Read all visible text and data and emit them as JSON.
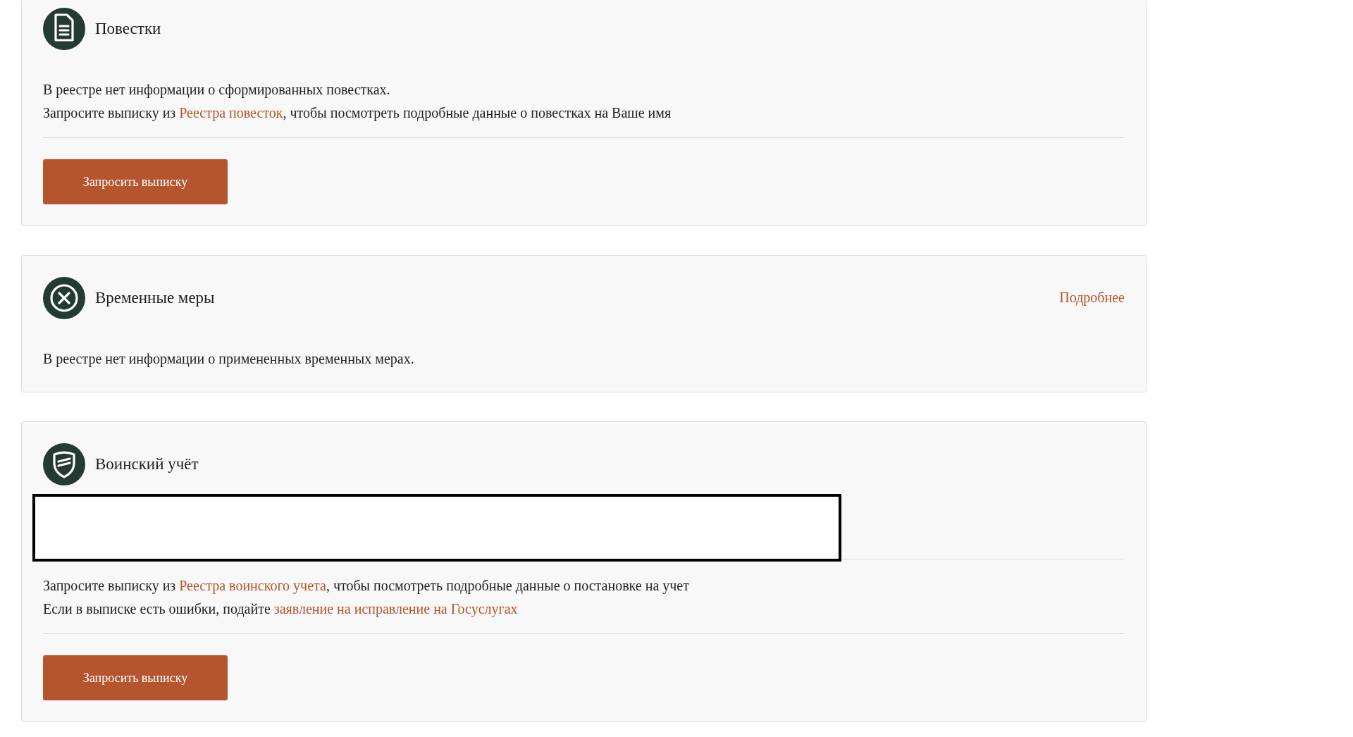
{
  "cards": [
    {
      "title": "Повестки",
      "redacted": false,
      "lines": [
        [
          {
            "text": "В реестре нет информации о сформированных повестках.",
            "link": false
          }
        ],
        [
          {
            "text": "Запросите выписку из ",
            "link": false
          },
          {
            "text": "Реестра повесток",
            "link": true
          },
          {
            "text": ", чтобы посмотреть подробные данные о повестках на Ваше имя",
            "link": false
          }
        ]
      ],
      "button": "Запросить выписку"
    },
    {
      "title": "Временные меры",
      "more": "Подробнее",
      "redacted": false,
      "lines": [
        [
          {
            "text": "В реестре нет информации о примененных временных мерах.",
            "link": false
          }
        ]
      ]
    },
    {
      "title": "Воинский учёт",
      "redacted": true,
      "lines": [
        [
          {
            "text": "Запросите выписку из ",
            "link": false
          },
          {
            "text": "Реестра воинского учета",
            "link": true
          },
          {
            "text": ",  чтобы посмотреть подробные данные о постановке на учет",
            "link": false
          }
        ],
        [
          {
            "text": "Если в выписке есть ошибки, подайте ",
            "link": false
          },
          {
            "text": "заявление на исправление на Госуслугах",
            "link": true
          }
        ]
      ],
      "button": "Запросить выписку"
    }
  ]
}
